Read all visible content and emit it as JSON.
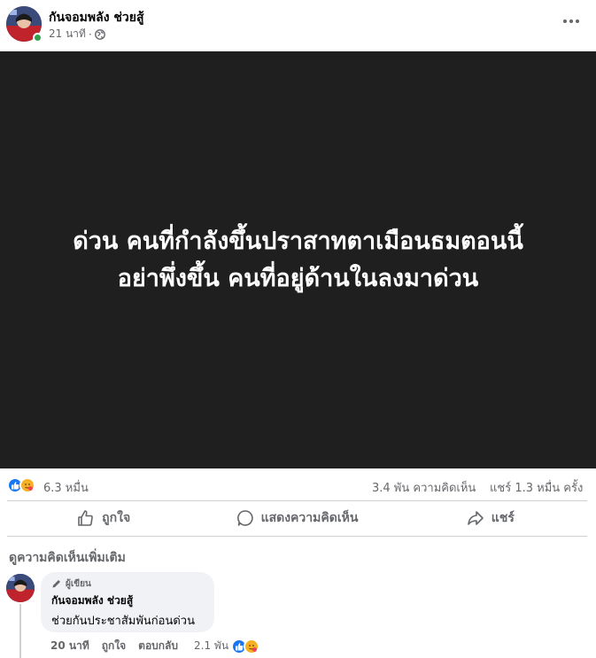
{
  "post": {
    "author": "กันจอมพลัง ช่วยสู้",
    "time": "21 นาที",
    "meta_sep": "·",
    "privacy_icon": "globe-icon",
    "more_icon": "more-horizontal-icon",
    "media_text_line1": "ด่วน คนที่กำลังขึ้นปราสาทตาเมือนธมตอนนี้",
    "media_text_line2": "อย่าพึ่งขึ้น คนที่อยู่ด้านในลงมาด่วน"
  },
  "summary": {
    "reaction_icons": [
      "like-icon",
      "care-icon"
    ],
    "reaction_count": "6.3 หมื่น",
    "comment_count": "3.4 พัน ความคิดเห็น",
    "share_count": "แชร์ 1.3 หมื่น ครั้ง"
  },
  "actions": {
    "like_label": "ถูกใจ",
    "comment_label": "แสดงความคิดเห็น",
    "share_label": "แชร์"
  },
  "comments": {
    "more_label": "ดูความคิดเห็นเพิ่มเติม",
    "items": [
      {
        "badge": "ผู้เขียน",
        "author": "กันจอมพลัง ช่วยสู้",
        "text": "ช่วยกันประชาสัมพันก่อนด่วน",
        "time": "20 นาที",
        "like": "ถูกใจ",
        "reply": "ตอบกลับ",
        "reaction_count": "2.1 พัน",
        "reaction_icons": [
          "like-icon",
          "care-icon"
        ]
      }
    ]
  },
  "colors": {
    "accent": "#1877f2",
    "media_bg": "#1f1f1f",
    "secondary_text": "#65676b",
    "online": "#31a24c"
  }
}
